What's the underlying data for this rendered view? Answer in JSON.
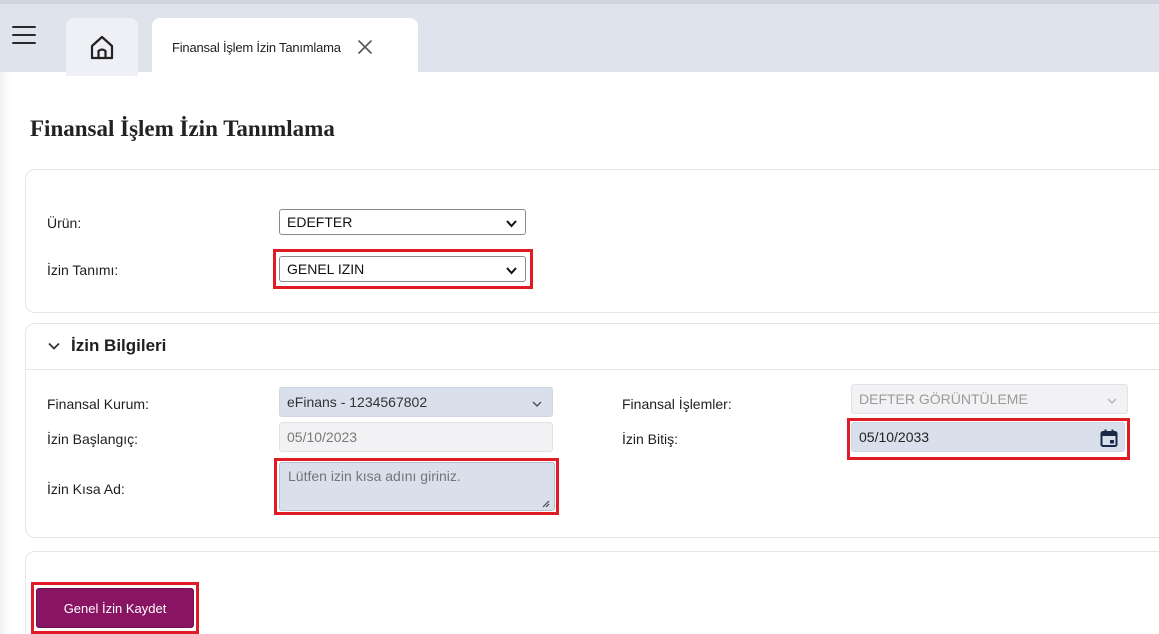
{
  "tabs": {
    "home_icon": "home-icon",
    "active_tab_label": "Finansal İşlem İzin Tanımlama"
  },
  "page": {
    "title": "Finansal İşlem İzin Tanımlama"
  },
  "form_top": {
    "product_label": "Ürün:",
    "product_value": "EDEFTER",
    "permission_def_label": "İzin Tanımı:",
    "permission_def_value": "GENEL IZIN"
  },
  "details": {
    "section_title": "İzin Bilgileri",
    "institution_label": "Finansal Kurum:",
    "institution_value": "eFinans - 1234567802",
    "operations_label": "Finansal İşlemler:",
    "operations_value": "DEFTER GÖRÜNTÜLEME",
    "start_label": "İzin Başlangıç:",
    "start_value": "05/10/2023",
    "end_label": "İzin Bitiş:",
    "end_value": "05/10/2033",
    "short_name_label": "İzin Kısa Ad:",
    "short_name_placeholder": "Lütfen izin kısa adını giriniz."
  },
  "actions": {
    "save_label": "Genel İzin Kaydet"
  },
  "colors": {
    "highlight": "#e01b24",
    "primary_button": "#8a1464",
    "field_blue": "#d9e0ec",
    "tabbar": "#dfe3ec"
  }
}
